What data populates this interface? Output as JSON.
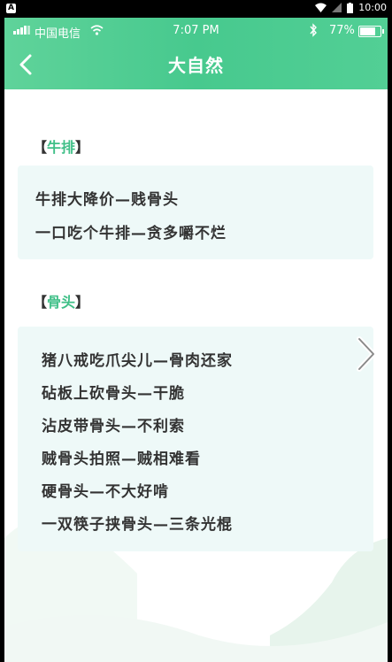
{
  "system_bar": {
    "time": "10:00"
  },
  "status": {
    "carrier": "中国电信",
    "time": "7:07 PM",
    "battery": "77%"
  },
  "header": {
    "title": "大自然"
  },
  "sections": [
    {
      "bracket_open": "【",
      "keyword": "牛排",
      "bracket_close": "】",
      "lines": [
        "牛排大降价—贱骨头",
        "一口吃个牛排—贪多嚼不烂"
      ]
    },
    {
      "bracket_open": "【",
      "keyword": "骨头",
      "bracket_close": "】",
      "lines": [
        "猪八戒吃爪尖儿—骨肉还家",
        "砧板上砍骨头—干脆",
        "沾皮带骨头—不利索",
        "贼骨头拍照—贼相难看",
        "硬骨头—不大好啃",
        "一双筷子挟骨头—三条光棍"
      ]
    }
  ],
  "colors": {
    "header_green": "#4bcb90",
    "keyword_green": "#3fbf87",
    "card_bg": "#eef9f8"
  },
  "icons": {
    "back": "chevron-left-icon",
    "next": "chevron-right-icon"
  }
}
